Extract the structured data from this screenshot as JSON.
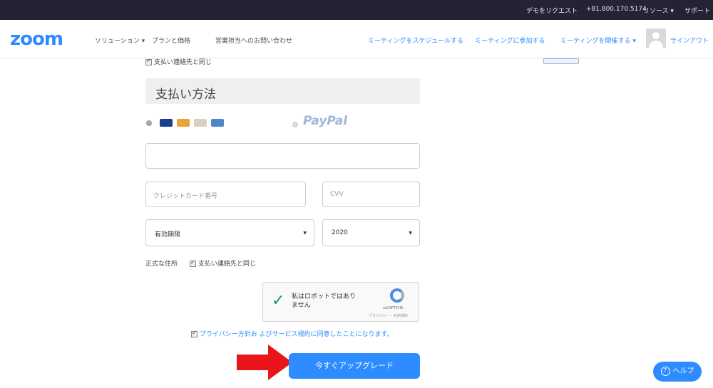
{
  "topbar": {
    "demo_request": "デモをリクエスト",
    "phone": "+81.800.170.5174",
    "resources": "リソース ▾",
    "support": "サポート"
  },
  "nav": {
    "logo": "zoom",
    "solutions": "ソリューション ▾",
    "plans": "プランと価格",
    "contact_sales": "営業担当へのお問い合わせ",
    "schedule_meeting": "ミーティングをスケジュールする",
    "join_meeting": "ミーティングに参加する",
    "host_meeting": "ミーティングを開催する ▾",
    "sign_out": "サインアウト"
  },
  "form": {
    "same_as_billing_top": "支払い連絡先と同じ",
    "payment_method_title": "支払い方法",
    "paypal": "PayPal",
    "card_number_placeholder": "クレジットカード番号",
    "cvv_placeholder": "CVV",
    "expiry_month": "有効期限",
    "expiry_year": "2020",
    "legal_address_label": "正式な住所",
    "same_as_billing": "支払い連絡先と同じ"
  },
  "captcha": {
    "text_line1": "私はロボットではあり",
    "text_line2": "ません",
    "brand": "reCAPTCHA",
    "terms": "プライバシー・利用規約"
  },
  "privacy_text": "プライバシー方針お よびサービス規約に同意したことになります。",
  "upgrade_button": "今すぐアップグレード",
  "help_button": "ヘルプ",
  "colors": {
    "accent": "#2d8cff",
    "topbar": "#232333",
    "arrow": "#e8161b"
  }
}
